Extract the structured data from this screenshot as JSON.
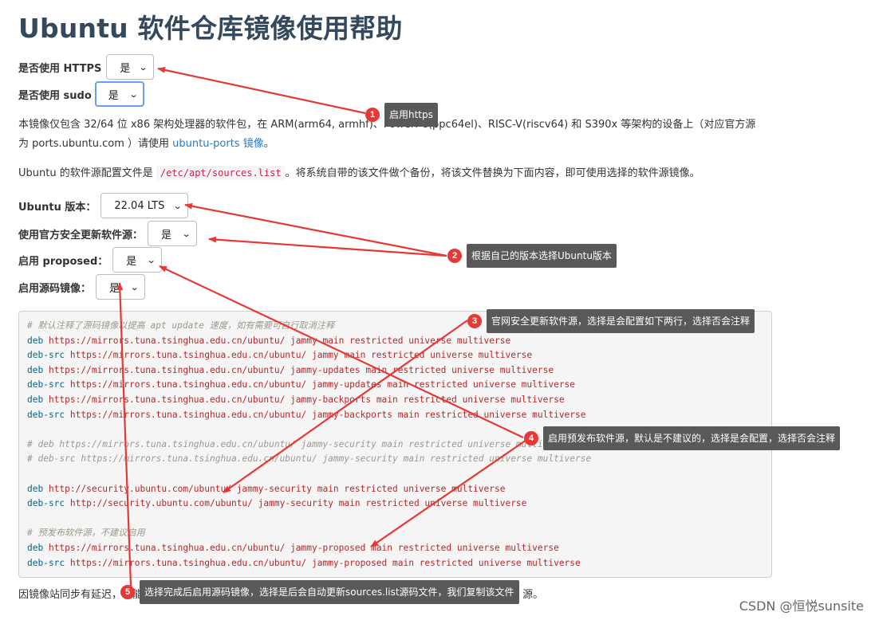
{
  "page": {
    "title": "Ubuntu 软件仓库镜像使用帮助"
  },
  "options": {
    "https": {
      "label": "是否使用 HTTPS",
      "value": "是"
    },
    "sudo": {
      "label": "是否使用 sudo",
      "value": "是"
    },
    "version": {
      "label": "Ubuntu 版本：",
      "value": "22.04 LTS"
    },
    "security": {
      "label": "使用官方安全更新软件源：",
      "value": "是"
    },
    "proposed": {
      "label": "启用 proposed：",
      "value": "是"
    },
    "source": {
      "label": "启用源码镜像：",
      "value": "是"
    }
  },
  "intro": {
    "line1": "本镜像仅包含 32/64 位 x86 架构处理器的软件包，在 ARM(arm64, armhf)、PowerPC(ppc64el)、RISC-V(riscv64) 和 S390x 等架构的设备上（对应官方源",
    "line2_prefix": "为 ports.ubuntu.com ）请使用 ",
    "line2_link": "ubuntu-ports 镜像",
    "line2_suffix": "。",
    "line3_prefix": "Ubuntu 的软件源配置文件是 ",
    "line3_code": "/etc/apt/sources.list",
    "line3_suffix": "。将系统自带的该文件做个备份，将该文件替换为下面内容，即可使用选择的软件源镜像。"
  },
  "code": {
    "l01": "# 默认注释了源码镜像以提高 apt update 速度，如有需要可自行取消注释",
    "l02_kw": "deb",
    "l02_rest": " https://mirrors.tuna.tsinghua.edu.cn/ubuntu/ jammy main restricted universe multiverse",
    "l03_kw": "deb-src",
    "l03_rest": " https://mirrors.tuna.tsinghua.edu.cn/ubuntu/ jammy main restricted universe multiverse",
    "l04_kw": "deb",
    "l04_rest": " https://mirrors.tuna.tsinghua.edu.cn/ubuntu/ jammy-updates main restricted universe multiverse",
    "l05_kw": "deb-src",
    "l05_rest": " https://mirrors.tuna.tsinghua.edu.cn/ubuntu/ jammy-updates main restricted universe multiverse",
    "l06_kw": "deb",
    "l06_rest": " https://mirrors.tuna.tsinghua.edu.cn/ubuntu/ jammy-backports main restricted universe multiverse",
    "l07_kw": "deb-src",
    "l07_rest": " https://mirrors.tuna.tsinghua.edu.cn/ubuntu/ jammy-backports main restricted universe multiverse",
    "l09": "# deb https://mirrors.tuna.tsinghua.edu.cn/ubuntu/ jammy-security main restricted universe multiverse",
    "l10": "# deb-src https://mirrors.tuna.tsinghua.edu.cn/ubuntu/ jammy-security main restricted universe multiverse",
    "l12_kw": "deb",
    "l12_rest": " http://security.ubuntu.com/ubuntu/ jammy-security main restricted universe multiverse",
    "l13_kw": "deb-src",
    "l13_rest": " http://security.ubuntu.com/ubuntu/ jammy-security main restricted universe multiverse",
    "l15": "# 预发布软件源，不建议启用",
    "l16_kw": "deb",
    "l16_rest": " https://mirrors.tuna.tsinghua.edu.cn/ubuntu/ jammy-proposed main restricted universe multiverse",
    "l17_kw": "deb-src",
    "l17_rest": " https://mirrors.tuna.tsinghua.edu.cn/ubuntu/ jammy-proposed main restricted universe multiverse"
  },
  "footer": {
    "text": "因镜像站同步有延迟，可能会导致生产环境系统不能及时检查、安装上最新的安全更新，不建议替换 security 源。"
  },
  "annotations": {
    "a1": {
      "num": "1",
      "text": "启用https"
    },
    "a2": {
      "num": "2",
      "text": "根据自己的版本选择Ubuntu版本"
    },
    "a3": {
      "num": "3",
      "text": "官网安全更新软件源，选择是会配置如下两行，选择否会注释"
    },
    "a4": {
      "num": "4",
      "text": "启用预发布软件源，默认是不建议的，选择是会配置，选择否会注释"
    },
    "a5": {
      "num": "5",
      "text": "选择完成后启用源码镜像，选择是后会自动更新sources.list源码文件，我们复制该文件"
    }
  },
  "watermark": "CSDN @恒悦sunsite",
  "colors": {
    "annotation_arrow": "#e53935",
    "annotation_badge": "#e53935",
    "annotation_note_bg": "#595959",
    "title": "#34495e",
    "link": "#2979c7",
    "code_keyword": "#00668c",
    "code_comment": "#9a9a8c",
    "code_text": "#b5282b"
  }
}
